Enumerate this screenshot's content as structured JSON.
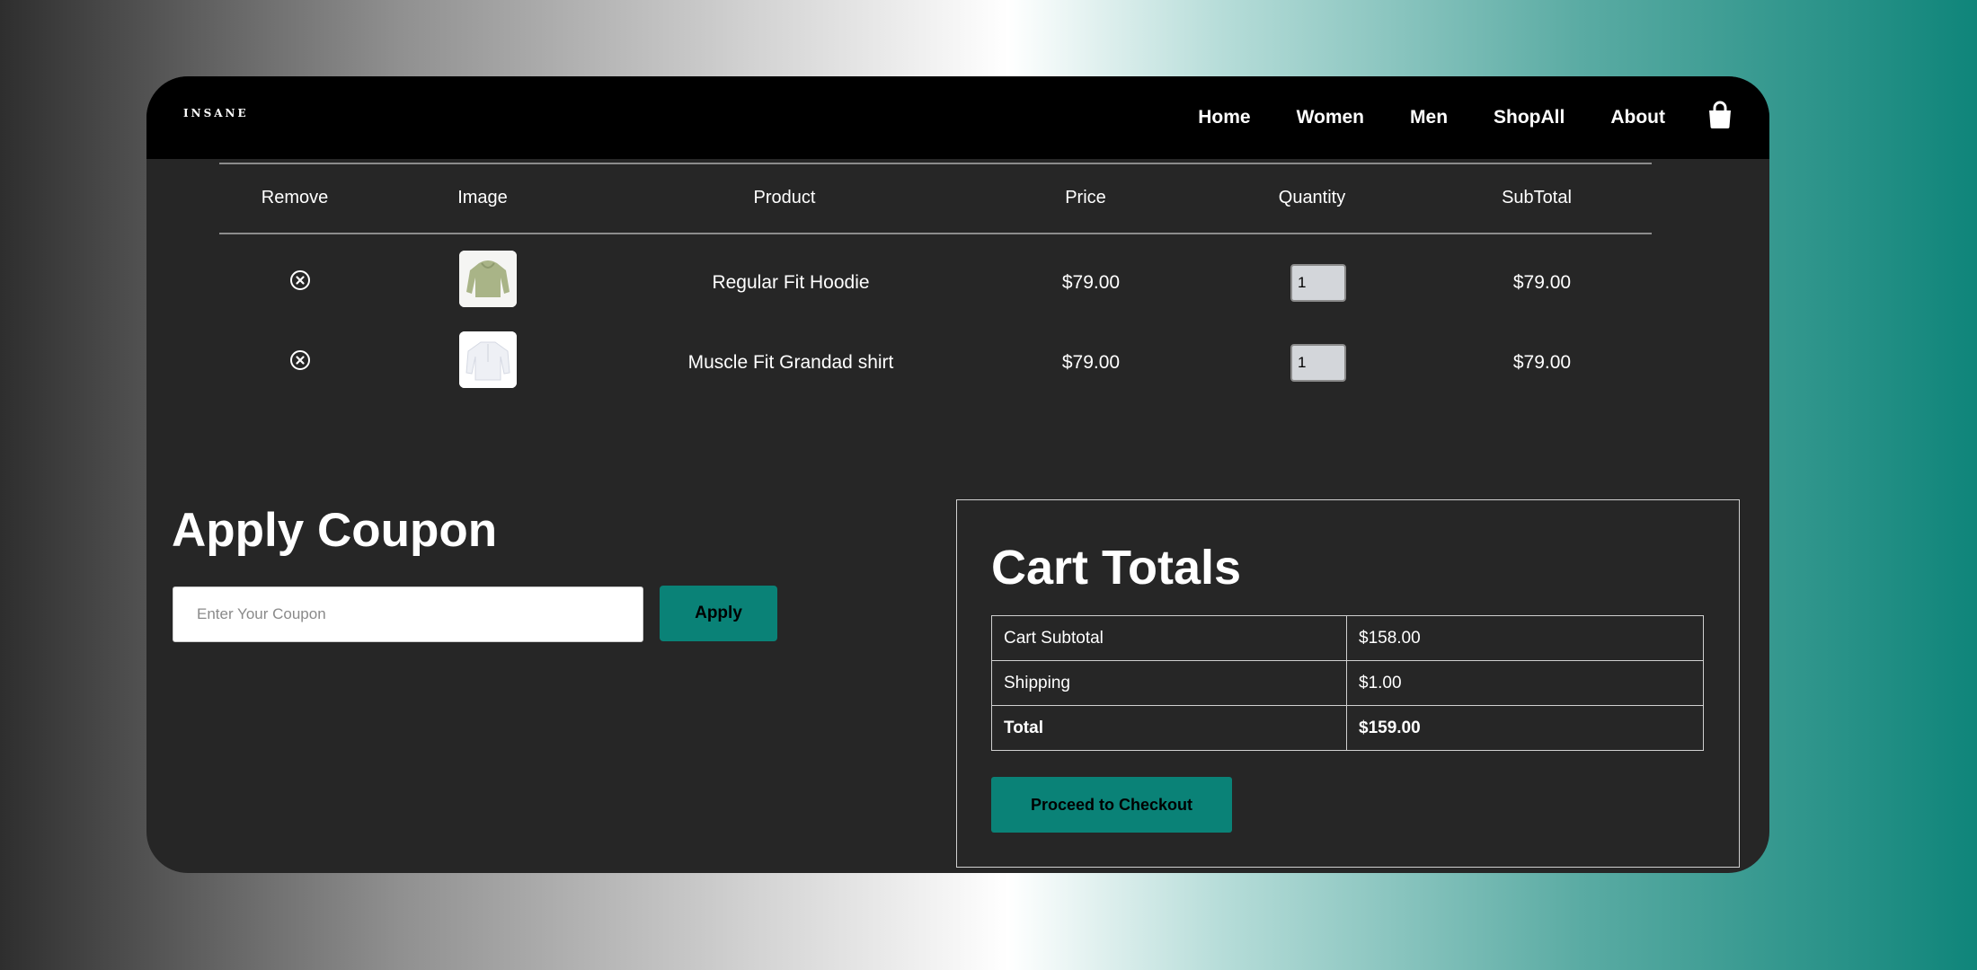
{
  "brand": {
    "logo": "INSANE"
  },
  "nav": {
    "links": [
      "Home",
      "Women",
      "Men",
      "ShopAll",
      "About"
    ],
    "cart_icon": "shopping-bag-icon"
  },
  "cart_table": {
    "headers": [
      "Remove",
      "Image",
      "Product",
      "Price",
      "Quantity",
      "SubTotal"
    ],
    "rows": [
      {
        "product": "Regular Fit Hoodie",
        "price": "$79.00",
        "quantity": "1",
        "subtotal": "$79.00",
        "image": "green-hoodie"
      },
      {
        "product": "Muscle Fit Grandad shirt",
        "price": "$79.00",
        "quantity": "1",
        "subtotal": "$79.00",
        "image": "white-shirt"
      }
    ],
    "remove_icon": "close-circle-icon"
  },
  "coupon": {
    "title": "Apply Coupon",
    "placeholder": "Enter Your Coupon",
    "button_label": "Apply"
  },
  "totals": {
    "title": "Cart Totals",
    "rows": [
      {
        "label": "Cart Subtotal",
        "value": "$158.00"
      },
      {
        "label": "Shipping",
        "value": "$1.00"
      },
      {
        "label": "Total",
        "value": "$159.00"
      }
    ],
    "checkout_label": "Proceed to Checkout"
  },
  "colors": {
    "accent": "#0a8277",
    "panel": "#262626",
    "navbar": "#000000"
  }
}
